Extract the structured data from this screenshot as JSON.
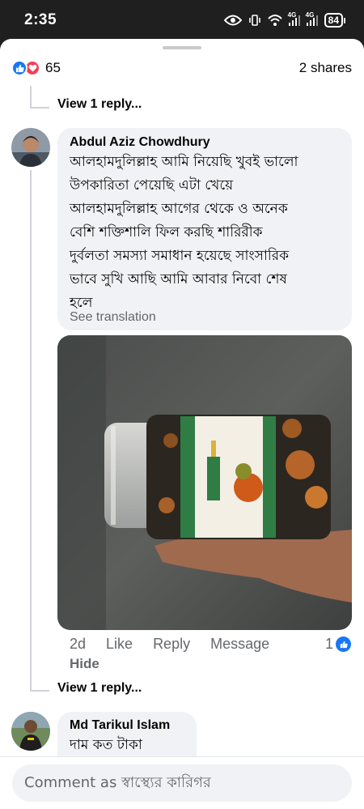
{
  "status_bar": {
    "time": "2:35",
    "battery": "84",
    "network_label_1": "4G",
    "network_label_2": "4G"
  },
  "post_stats": {
    "reaction_count": "65",
    "shares": "2 shares"
  },
  "view_reply_top": "View 1 reply...",
  "comments": [
    {
      "author": "Abdul Aziz Chowdhury",
      "lines": [
        "আলহামদুলিল্লাহ আমি নিয়েছি খুবই ভালো",
        "উপকারিতা পেয়েছি এটা খেয়ে",
        "আলহামদুলিল্লাহ আগের থেকে ও অনেক",
        "বেশি শক্তিশালি ফিল করছি শারিরীক",
        "দুর্বলতা সমস্যা সমাধান হয়েছে সাংসারিক",
        "ভাবে সুখি আছি আমি আবার নিবো শেষ",
        "হলে"
      ],
      "see_translation": "See translation",
      "time": "2d",
      "like": "Like",
      "reply": "Reply",
      "message": "Message",
      "like_count": "1",
      "hide": "Hide",
      "view_reply": "View 1 reply..."
    },
    {
      "author": "Md Tarikul Islam",
      "text": "দাম কত টাকা"
    }
  ],
  "composer": {
    "placeholder": "Comment as স্বাস্থ্যের কারিগর"
  },
  "colors": {
    "facebook_blue": "#1877f2",
    "love_red": "#f33e58",
    "bubble_gray": "#f0f2f5",
    "meta_gray": "#65676b"
  }
}
